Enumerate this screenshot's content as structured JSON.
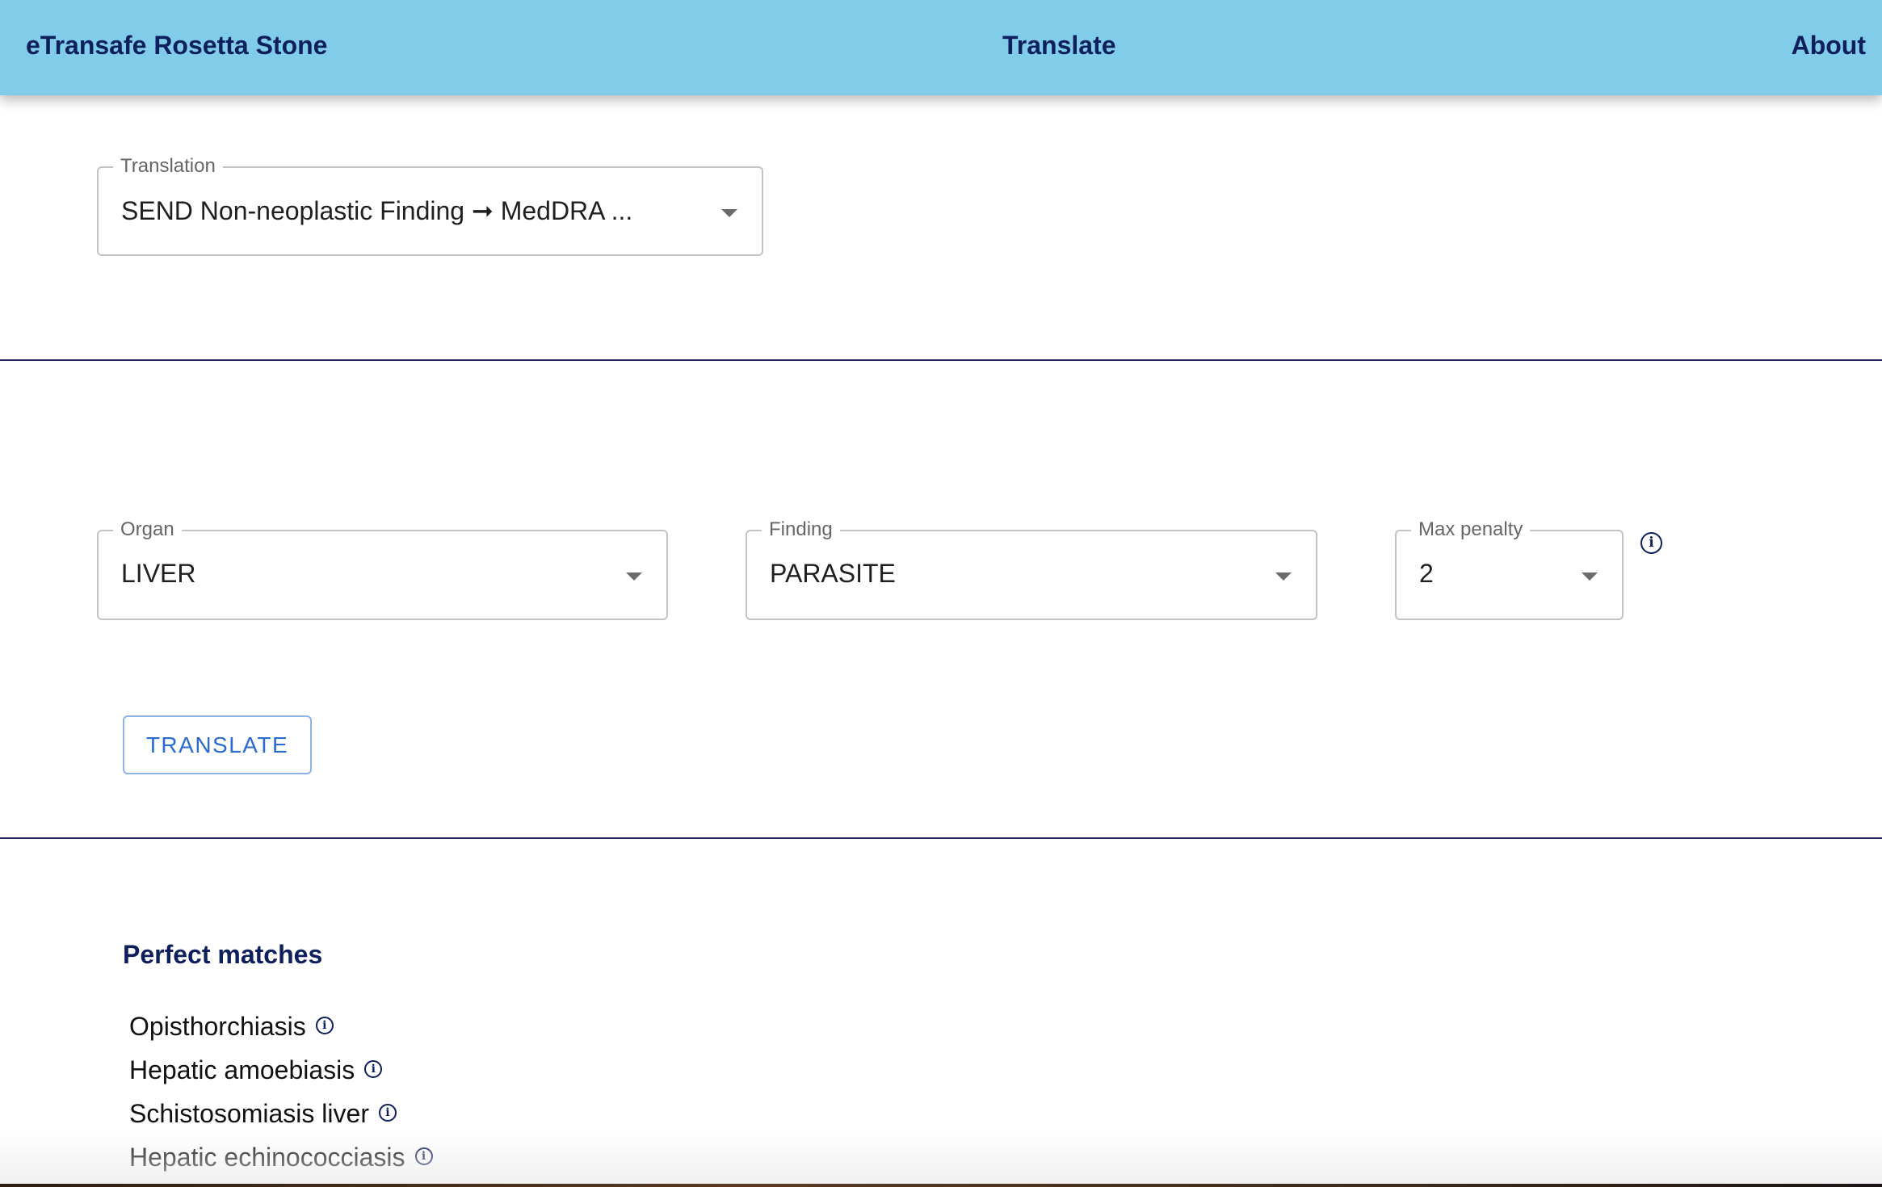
{
  "header": {
    "brand": "eTransafe Rosetta Stone",
    "nav_translate": "Translate",
    "nav_about": "About"
  },
  "translation": {
    "label": "Translation",
    "value": "SEND Non-neoplastic Finding ➞ MedDRA ..."
  },
  "organ": {
    "label": "Organ",
    "value": "LIVER"
  },
  "finding": {
    "label": "Finding",
    "value": "PARASITE"
  },
  "max_penalty": {
    "label": "Max penalty",
    "value": "2"
  },
  "info_icon": "info-circle-icon",
  "translate_button": "TRANSLATE",
  "results": {
    "title": "Perfect matches",
    "items": [
      "Opisthorchiasis",
      "Hepatic amoebiasis",
      "Schistosomiasis liver",
      "Hepatic echinococciasis"
    ]
  },
  "colors": {
    "header_bg": "#81cce8",
    "header_text": "#0d1f5c",
    "button_text": "#2a6bd1",
    "divider": "#1a2660"
  }
}
